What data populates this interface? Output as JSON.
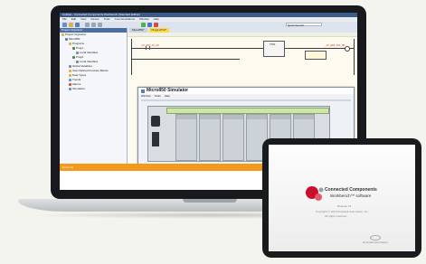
{
  "app": {
    "title": "Untitled - Connected Components Workbench (Standard Edition)",
    "menu": [
      "File",
      "Edit",
      "View",
      "Device",
      "Tools",
      "Communications",
      "Window",
      "Help"
    ],
    "quick_search": "Quick Search"
  },
  "project_organizer": {
    "header": "Project Organizer",
    "items": [
      {
        "label": "Project Organizer",
        "indent": 0,
        "icon": "folder-icon"
      },
      {
        "label": "Micro850",
        "indent": 1,
        "icon": "controller-icon"
      },
      {
        "label": "Programs",
        "indent": 2,
        "icon": "folder-icon"
      },
      {
        "label": "Prog1",
        "indent": 3,
        "icon": "program-icon"
      },
      {
        "label": "Local Variables",
        "indent": 4,
        "icon": "variables-icon"
      },
      {
        "label": "Prog2",
        "indent": 3,
        "icon": "program-icon"
      },
      {
        "label": "Local Variables",
        "indent": 4,
        "icon": "variables-icon"
      },
      {
        "label": "Global Variables",
        "indent": 2,
        "icon": "variables-icon"
      },
      {
        "label": "User-Defined Function Blocks",
        "indent": 2,
        "icon": "folder-icon"
      },
      {
        "label": "Data Types",
        "indent": 2,
        "icon": "folder-icon"
      },
      {
        "label": "Trends",
        "indent": 2,
        "icon": "trend-icon"
      },
      {
        "label": "Alarms",
        "indent": 2,
        "icon": "alarm-icon"
      },
      {
        "label": "Simulation",
        "indent": 2,
        "icon": "sim-icon"
      }
    ]
  },
  "editor": {
    "tabs": [
      "Micro850*",
      "Prog1-POU*"
    ],
    "active_tab": 1,
    "rung_label_left": "_IO_EM_DI_00",
    "rung_label_right": "_IO_EM_DO_00",
    "block_label": "TON"
  },
  "simulator": {
    "title": "Micro850 Simulator",
    "menu": [
      "Window",
      "Tools",
      "Help"
    ]
  },
  "status_bar": {
    "text": "Error List"
  },
  "tablet": {
    "brand": "Connected Components",
    "product": "Workbench™ software",
    "release": "Release 12",
    "fine_print": [
      "Copyright © 2019 Rockwell Automation, Inc.",
      "All rights reserved.",
      "Rockwell Automation"
    ]
  },
  "colors": {
    "brand_red": "#c8102e",
    "accent_orange": "#f39a1d",
    "title_blue": "#3b5a86",
    "plc_green": "#cfe7a6"
  }
}
